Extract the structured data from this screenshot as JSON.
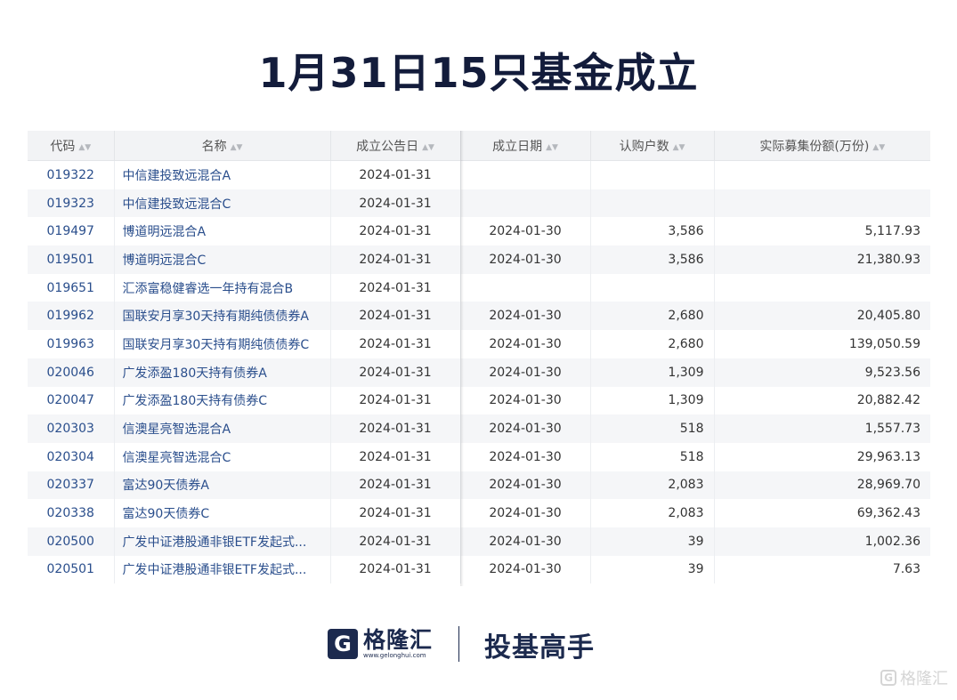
{
  "title": "1月31日15只基金成立",
  "table": {
    "headers": [
      "代码",
      "名称",
      "成立公告日",
      "成立日期",
      "认购户数",
      "实际募集份额(万份)"
    ],
    "sort_icon": "sort-arrows-icon",
    "rows": [
      [
        "019322",
        "中信建投致远混合A",
        "2024-01-31",
        "",
        "",
        ""
      ],
      [
        "019323",
        "中信建投致远混合C",
        "2024-01-31",
        "",
        "",
        ""
      ],
      [
        "019497",
        "博道明远混合A",
        "2024-01-31",
        "2024-01-30",
        "3,586",
        "5,117.93"
      ],
      [
        "019501",
        "博道明远混合C",
        "2024-01-31",
        "2024-01-30",
        "3,586",
        "21,380.93"
      ],
      [
        "019651",
        "汇添富稳健睿选一年持有混合B",
        "2024-01-31",
        "",
        "",
        ""
      ],
      [
        "019962",
        "国联安月享30天持有期纯债债券A",
        "2024-01-31",
        "2024-01-30",
        "2,680",
        "20,405.80"
      ],
      [
        "019963",
        "国联安月享30天持有期纯债债券C",
        "2024-01-31",
        "2024-01-30",
        "2,680",
        "139,050.59"
      ],
      [
        "020046",
        "广发添盈180天持有债券A",
        "2024-01-31",
        "2024-01-30",
        "1,309",
        "9,523.56"
      ],
      [
        "020047",
        "广发添盈180天持有债券C",
        "2024-01-31",
        "2024-01-30",
        "1,309",
        "20,882.42"
      ],
      [
        "020303",
        "信澳星亮智选混合A",
        "2024-01-31",
        "2024-01-30",
        "518",
        "1,557.73"
      ],
      [
        "020304",
        "信澳星亮智选混合C",
        "2024-01-31",
        "2024-01-30",
        "518",
        "29,963.13"
      ],
      [
        "020337",
        "富达90天债券A",
        "2024-01-31",
        "2024-01-30",
        "2,083",
        "28,969.70"
      ],
      [
        "020338",
        "富达90天债券C",
        "2024-01-31",
        "2024-01-30",
        "2,083",
        "69,362.43"
      ],
      [
        "020500",
        "广发中证港股通非银ETF发起式...",
        "2024-01-31",
        "2024-01-30",
        "39",
        "1,002.36"
      ],
      [
        "020501",
        "广发中证港股通非银ETF发起式...",
        "2024-01-31",
        "2024-01-30",
        "39",
        "7.63"
      ]
    ]
  },
  "footer": {
    "logo_mark": "G",
    "logo_name": "格隆汇",
    "logo_url": "www.gelonghui.com",
    "slogan": "投基高手"
  },
  "watermark": {
    "mark": "G",
    "text": "格隆汇"
  },
  "colors": {
    "title": "#131c3b",
    "link": "#2a4e8c",
    "brand": "#1c2a4e",
    "header_bg": "#f2f3f5",
    "row_alt_bg": "#f5f6f8"
  }
}
